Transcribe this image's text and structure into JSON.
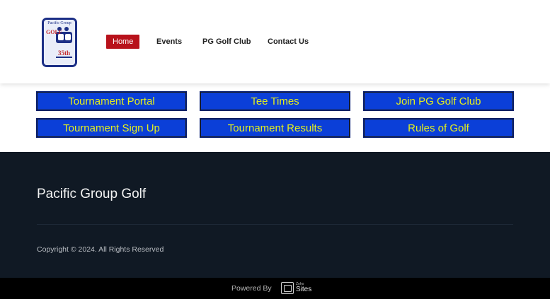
{
  "logo": {
    "top_text": "Pacific Group",
    "side_text": "GOLF",
    "anniversary": "35th"
  },
  "nav": {
    "items": [
      {
        "label": "Home",
        "active": true
      },
      {
        "label": "Events"
      },
      {
        "label": "PG Golf Club"
      },
      {
        "label": "Contact Us"
      }
    ]
  },
  "buttons": [
    {
      "label": "Tournament Portal"
    },
    {
      "label": "Tee Times"
    },
    {
      "label": "Join PG Golf Club"
    },
    {
      "label": "Tournament Sign Up"
    },
    {
      "label": "Tournament Results"
    },
    {
      "label": "Rules of Golf"
    }
  ],
  "footer": {
    "title": "Pacific Group Golf",
    "copyright": "Copyright © 2024. All Rights Reserved"
  },
  "bottom_bar": {
    "powered_by": "Powered By",
    "brand_small": "Zoho",
    "brand_name": "Sites"
  },
  "colors": {
    "nav_active_bg": "#b8121b",
    "button_bg": "#0b3fd8",
    "button_text": "#e4ef1d",
    "footer_bg": "#101924",
    "bottom_bar_bg": "#000000"
  }
}
